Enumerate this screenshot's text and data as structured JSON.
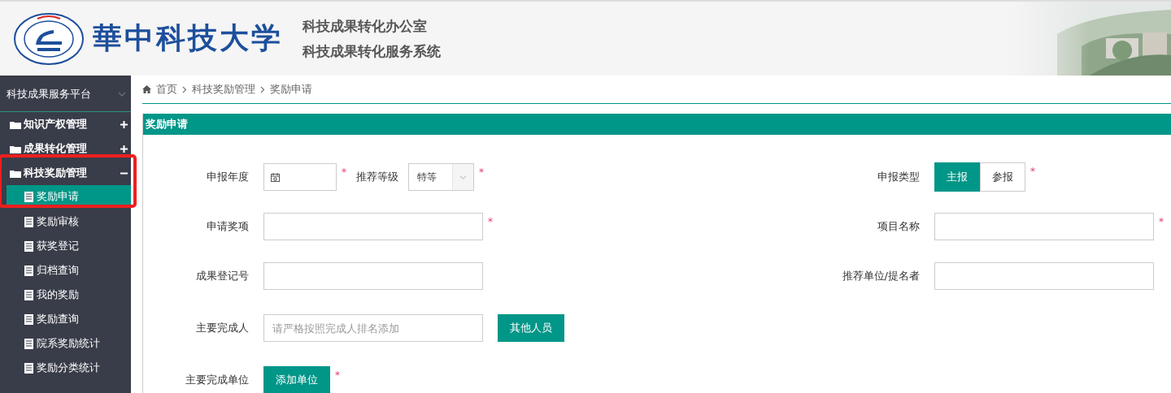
{
  "header": {
    "logo_text": "華中科技大学",
    "lines": [
      "科技成果转化办公室",
      "科技成果转化服务系统"
    ]
  },
  "sidebar": {
    "title": "科技成果服务平台",
    "groups": [
      {
        "label": "知识产权管理",
        "expanded": false,
        "highlighted": false
      },
      {
        "label": "成果转化管理",
        "expanded": false,
        "highlighted": false
      },
      {
        "label": "科技奖励管理",
        "expanded": true,
        "highlighted": true,
        "children": [
          {
            "label": "奖励申请",
            "selected": true
          },
          {
            "label": "奖励审核",
            "selected": false
          },
          {
            "label": "获奖登记",
            "selected": false
          },
          {
            "label": "归档查询",
            "selected": false
          },
          {
            "label": "我的奖励",
            "selected": false
          },
          {
            "label": "奖励查询",
            "selected": false
          },
          {
            "label": "院系奖励统计",
            "selected": false
          },
          {
            "label": "奖励分类统计",
            "selected": false
          }
        ]
      }
    ]
  },
  "breadcrumb": [
    "首页",
    "科技奖励管理",
    "奖励申请"
  ],
  "panel": {
    "title": "奖励申请",
    "rows": [
      {
        "left": [
          {
            "kind": "date",
            "label": "申报年度",
            "required_mark": "*"
          },
          {
            "kind": "select",
            "label": "推荐等级",
            "value": "特等",
            "required_mark": "*"
          }
        ],
        "right": [
          {
            "kind": "toggle",
            "label": "申报类型",
            "required_mark": "*",
            "options": [
              {
                "label": "主报",
                "selected": true
              },
              {
                "label": "参报",
                "selected": false
              }
            ]
          }
        ]
      },
      {
        "left": [
          {
            "kind": "text",
            "label": "申请奖项",
            "required_mark": "*"
          }
        ],
        "right": [
          {
            "kind": "text",
            "label": "项目名称",
            "required_mark": "*"
          }
        ]
      },
      {
        "left": [
          {
            "kind": "text",
            "label": "成果登记号"
          }
        ],
        "right": [
          {
            "kind": "text",
            "label": "推荐单位/提名者"
          }
        ]
      },
      {
        "left": [
          {
            "kind": "text",
            "label": "主要完成人",
            "placeholder": "请严格按照完成人排名添加"
          },
          {
            "kind": "button",
            "text": "其他人员"
          }
        ]
      },
      {
        "left": [
          {
            "kind": "button",
            "label": "主要完成单位",
            "text": "添加单位",
            "required_mark": "*"
          }
        ]
      }
    ]
  }
}
